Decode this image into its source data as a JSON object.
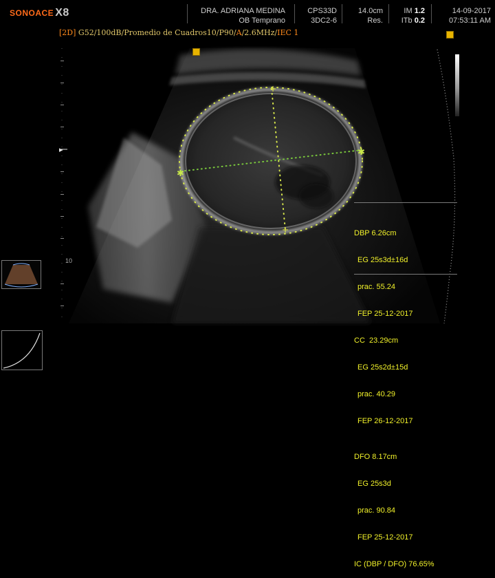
{
  "header": {
    "logo_brand": "SONOACE",
    "logo_model": "X8",
    "doctor": "DRA. ADRIANA MEDINA",
    "preset": "OB Temprano",
    "probe_top": "CPS33D",
    "probe_bottom": "3DC2-6",
    "depth": "14.0cm",
    "res_label": "Res.",
    "im_label": "IM",
    "im_value": "1.2",
    "itb_label": "ITb",
    "itb_value": "0.2",
    "date": "14-09-2017",
    "time": "07:53:11 AM"
  },
  "imaging_params": {
    "prefix": "[2D]",
    "main": "G52/100dB/Promedio de Cuadros10/P90/",
    "a_label": "A",
    "rest": "/2.6MHz/",
    "iec": "IEC 1"
  },
  "depth_scale": {
    "label_10": "10"
  },
  "measurements": {
    "dbp": {
      "title": "DBP 6.26cm",
      "eg": "EG 25s3d±16d",
      "prac": "prac. 55.24",
      "fep": "FEP 25-12-2017"
    },
    "cc": {
      "title": "CC  23.29cm",
      "eg": "EG 25s2d±15d",
      "prac": "prac. 40.29",
      "fep": "FEP 26-12-2017"
    },
    "dfo": {
      "title": "DFO 8.17cm",
      "eg": "EG 25s3d",
      "prac": "prac. 90.84",
      "fep": "FEP 25-12-2017"
    },
    "ic": "IC (DBP / DFO) 76.65%"
  },
  "colors": {
    "brand_orange": "#ff6b1a",
    "measurement_yellow": "#f2f22a",
    "caliper_green": "#7ac83c",
    "param_text": "#e0c66a"
  },
  "icons": [
    "freeze-indicator-icon",
    "caliper-marker-icon",
    "focus-marker-icon",
    "probe-orientation-marker-icon"
  ]
}
